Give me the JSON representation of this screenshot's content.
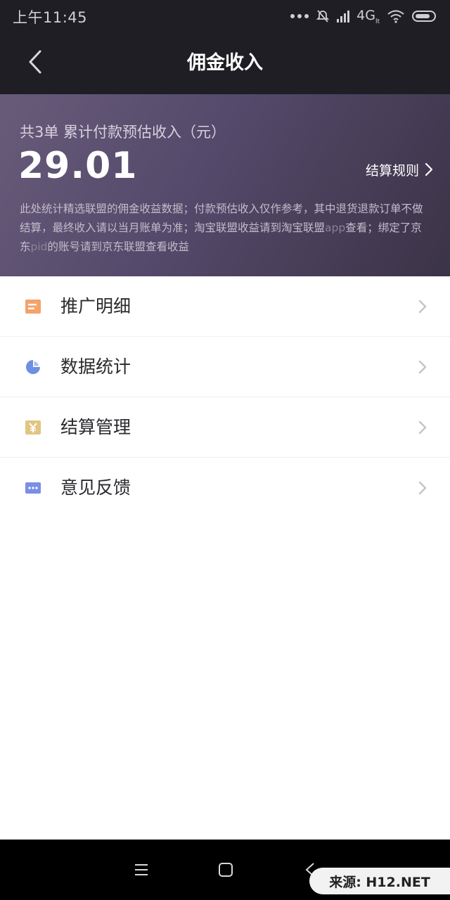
{
  "status_bar": {
    "time": "上午11:45",
    "network": "4G",
    "network_sub": "lt",
    "icons": [
      "more-dots-icon",
      "alarm-off-icon",
      "signal-icon",
      "wifi-icon",
      "battery-icon"
    ]
  },
  "header": {
    "title": "佣金收入",
    "back_icon": "chevron-left-icon"
  },
  "summary": {
    "label": "共3单 累计付款预估收入（元）",
    "amount": "29.01",
    "rules_link": "结算规则",
    "desc_part1": "此处统计精选联盟的佣金收益数据；付款预估收入仅作参考，其中退货退款订单不做结算，最终收入请以当月账单为准；淘宝联盟收益请到淘宝联盟",
    "desc_app": "app",
    "desc_part2": "查看；绑定了京东",
    "desc_pid": "pid",
    "desc_part3": "的账号请到京东联盟查看收益"
  },
  "menu": {
    "items": [
      {
        "label": "推广明细",
        "icon": "document-list-icon",
        "color": "#f3a36b"
      },
      {
        "label": "数据统计",
        "icon": "pie-chart-icon",
        "color": "#6f8fe0"
      },
      {
        "label": "结算管理",
        "icon": "yen-icon",
        "color": "#e2c583"
      },
      {
        "label": "意见反馈",
        "icon": "chat-bubble-icon",
        "color": "#7b8ee6"
      }
    ]
  },
  "nav_bar": {
    "icons": [
      "menu-icon",
      "home-square-icon",
      "back-triangle-icon"
    ]
  },
  "watermark": {
    "text": "来源: H12.NET"
  },
  "colors": {
    "header_bg": "#1f1e25",
    "hero_gradient_start": "#685b7a",
    "hero_gradient_end": "#3b3346"
  }
}
